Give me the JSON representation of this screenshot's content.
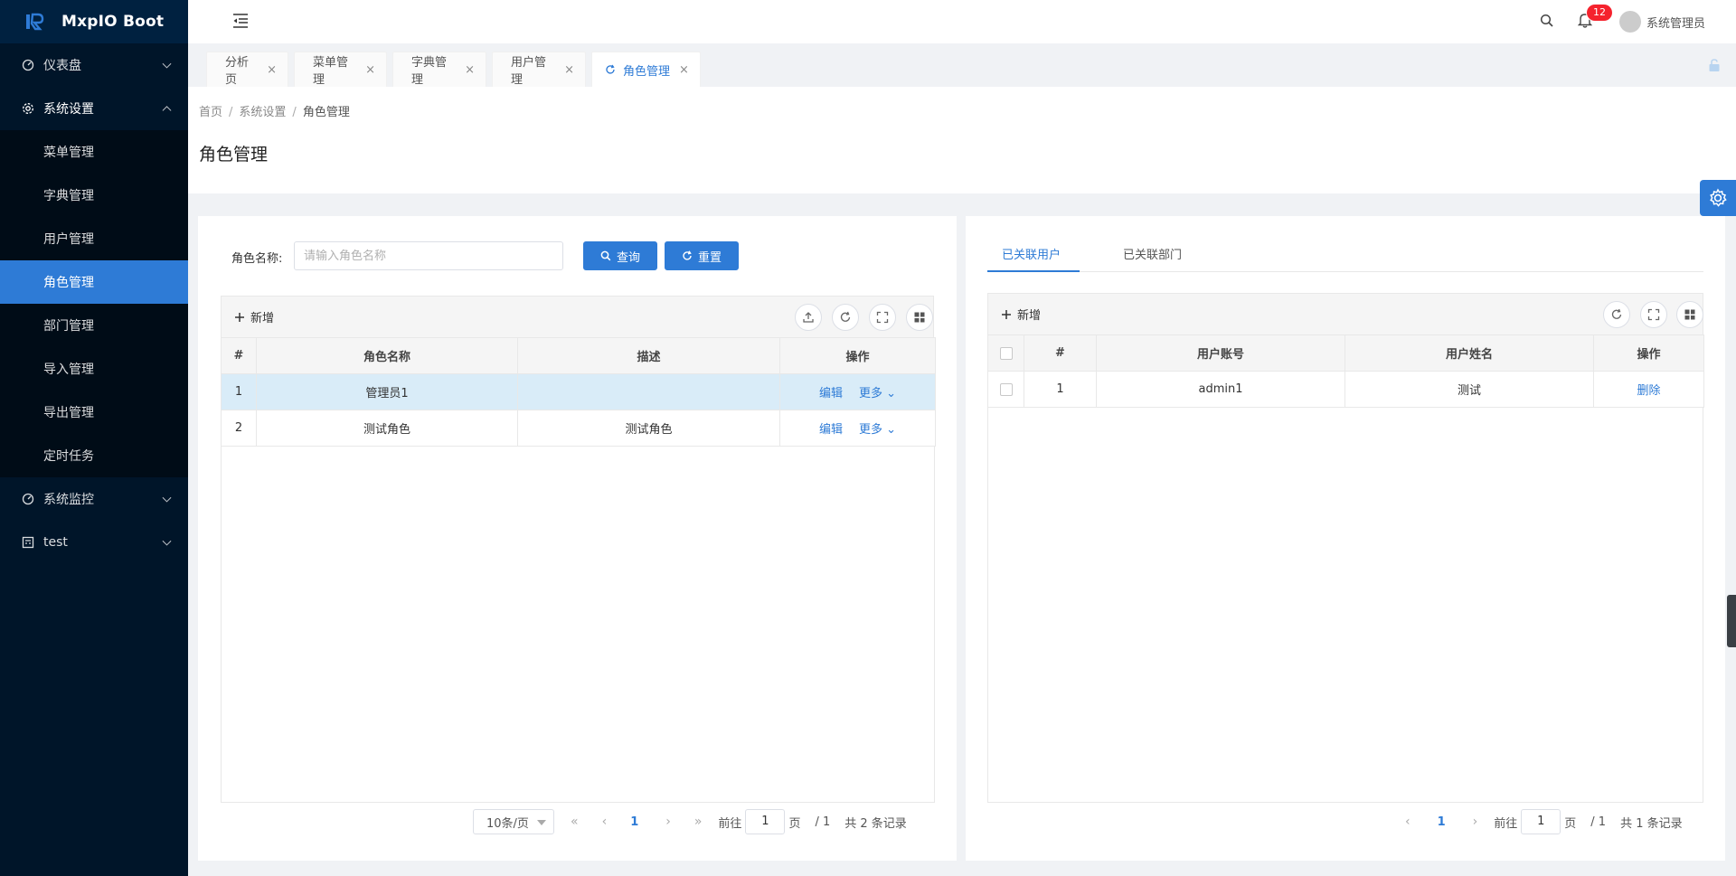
{
  "app": {
    "name": "MxpIO Boot"
  },
  "sidebar": {
    "items": [
      {
        "label": "仪表盘",
        "icon": "dashboard-icon"
      },
      {
        "label": "系统设置",
        "icon": "gear-icon"
      },
      {
        "label": "系统监控",
        "icon": "monitor-icon"
      },
      {
        "label": "test",
        "icon": "calendar-icon"
      }
    ],
    "submenu": [
      "菜单管理",
      "字典管理",
      "用户管理",
      "角色管理",
      "部门管理",
      "导入管理",
      "导出管理",
      "定时任务"
    ],
    "active_sub": "角色管理"
  },
  "header": {
    "notification_count": "12",
    "user_name": "系统管理员"
  },
  "tabs": [
    "分析页",
    "菜单管理",
    "字典管理",
    "用户管理",
    "角色管理"
  ],
  "breadcrumb": {
    "home": "首页",
    "parent": "系统设置",
    "current": "角色管理",
    "sep": "/"
  },
  "page_title": "角色管理",
  "left": {
    "search_label": "角色名称:",
    "search_placeholder": "请输入角色名称",
    "query_label": "查询",
    "reset_label": "重置",
    "add_label": "新增",
    "columns": [
      "#",
      "角色名称",
      "描述",
      "操作"
    ],
    "rows": [
      {
        "no": "1",
        "name": "管理员1",
        "desc": "",
        "edit": "编辑",
        "more": "更多"
      },
      {
        "no": "2",
        "name": "测试角色",
        "desc": "测试角色",
        "edit": "编辑",
        "more": "更多"
      }
    ],
    "pager": {
      "page_size": "10条/页",
      "current": "1",
      "goto_prefix": "前往",
      "goto_value": "1",
      "goto_suffix": "页",
      "total_pages": "/ 1",
      "total": "共 2 条记录"
    }
  },
  "right": {
    "tabs": [
      "已关联用户",
      "已关联部门"
    ],
    "add_label": "新增",
    "columns": [
      "#",
      "用户账号",
      "用户姓名",
      "操作"
    ],
    "rows": [
      {
        "no": "1",
        "account": "admin1",
        "name": "测试",
        "action": "删除"
      }
    ],
    "pager": {
      "current": "1",
      "goto_prefix": "前往",
      "goto_value": "1",
      "goto_suffix": "页",
      "total_pages": "/ 1",
      "total": "共 1 条记录"
    }
  },
  "colors": {
    "primary": "#2e7bd6",
    "sidebar": "#001529",
    "submenu": "#000c17",
    "badge": "#f5222d"
  }
}
